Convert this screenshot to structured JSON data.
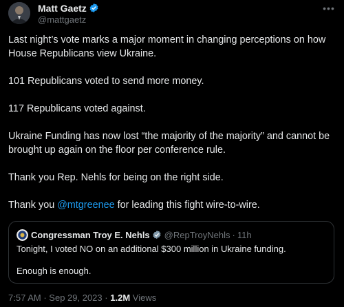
{
  "author": {
    "display_name": "Matt Gaetz",
    "handle": "@mattgaetz",
    "verified_icon": "verified-badge-icon",
    "avatar_icon": "profile-photo"
  },
  "more_icon": "more-options-icon",
  "tweet": {
    "paragraphs": [
      "Last night’s vote marks a major moment in changing perceptions on how House Republicans view Ukraine.",
      "101 Republicans voted to send more money.",
      "117 Republicans voted against.",
      "Ukraine Funding has now lost “the majority of the majority” and cannot be brought up again on the floor per conference rule.",
      "Thank you Rep. Nehls for being on the right side."
    ],
    "last_prefix": "Thank you ",
    "last_mention": "@mtgreenee",
    "last_suffix": " for leading this fight wire-to-wire."
  },
  "quote": {
    "display_name": "Congressman Troy E. Nehls",
    "handle": "@RepTroyNehls",
    "separator": "·",
    "time": "11h",
    "line1": "Tonight, I voted NO on an additional $300 million in Ukraine funding.",
    "line2": "Enough is enough."
  },
  "footer": {
    "time": "7:57 AM",
    "separator": "·",
    "date": "Sep 29, 2023",
    "separator2": "·",
    "views_count": "1.2M",
    "views_label": "Views"
  },
  "colors": {
    "background": "#000000",
    "text": "#e7e9ea",
    "secondary": "#71767b",
    "accent": "#1d9bf0",
    "border": "#2f3336"
  }
}
